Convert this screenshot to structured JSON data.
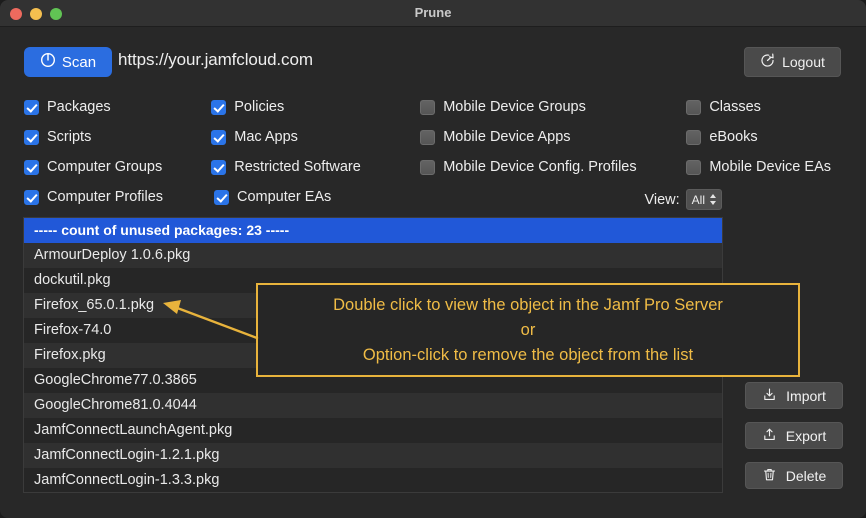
{
  "window": {
    "title": "Prune",
    "traffic_lights": [
      "close-button",
      "minimize-button",
      "maximize-button"
    ]
  },
  "toolbar": {
    "scan_label": "Scan",
    "scan_icon": "power-icon",
    "url": "https://your.jamfcloud.com",
    "logout_label": "Logout",
    "logout_icon": "logout-clock-icon"
  },
  "checkboxes": [
    [
      {
        "label": "Packages",
        "checked": true
      },
      {
        "label": "Policies",
        "checked": true
      },
      {
        "label": "Mobile Device Groups",
        "checked": false
      },
      {
        "label": "Classes",
        "checked": false
      }
    ],
    [
      {
        "label": "Scripts",
        "checked": true
      },
      {
        "label": "Mac Apps",
        "checked": true
      },
      {
        "label": "Mobile Device Apps",
        "checked": false
      },
      {
        "label": "eBooks",
        "checked": false
      }
    ],
    [
      {
        "label": "Computer Groups",
        "checked": true
      },
      {
        "label": "Restricted Software",
        "checked": true
      },
      {
        "label": "Mobile Device Config. Profiles",
        "checked": false
      },
      {
        "label": "Mobile Device EAs",
        "checked": false
      }
    ],
    [
      {
        "label": "Computer Profiles",
        "checked": true
      },
      {
        "label": "Computer EAs",
        "checked": true
      },
      {
        "label": "",
        "checked": null
      },
      {
        "label": "",
        "checked": null
      }
    ]
  ],
  "view": {
    "label": "View:",
    "selected": "All",
    "options": [
      "All"
    ]
  },
  "list": {
    "header": "----- count of unused packages: 23 -----",
    "count": 23,
    "items": [
      "ArmourDeploy 1.0.6.pkg",
      "dockutil.pkg",
      "Firefox_65.0.1.pkg",
      "Firefox-74.0",
      "Firefox.pkg",
      "GoogleChrome77.0.3865",
      "GoogleChrome81.0.4044",
      "JamfConnectLaunchAgent.pkg",
      "JamfConnectLogin-1.2.1.pkg",
      "JamfConnectLogin-1.3.3.pkg"
    ]
  },
  "side_buttons": [
    {
      "label": "Import",
      "icon": "import-tray-icon"
    },
    {
      "label": "Export",
      "icon": "export-tray-icon"
    },
    {
      "label": "Delete",
      "icon": "trash-icon"
    }
  ],
  "callout": {
    "lines": [
      "Double click to view the object in the Jamf Pro Server",
      "or",
      "Option-click to remove the object from the list"
    ],
    "border_color": "#e8b33c",
    "text_color": "#f0bc46"
  },
  "colors": {
    "accent_blue": "#2b6de0",
    "selection_blue": "#2158d8",
    "window_bg": "#282828",
    "titlebar_bg": "#323232",
    "list_bg": "#2b2b2b"
  }
}
